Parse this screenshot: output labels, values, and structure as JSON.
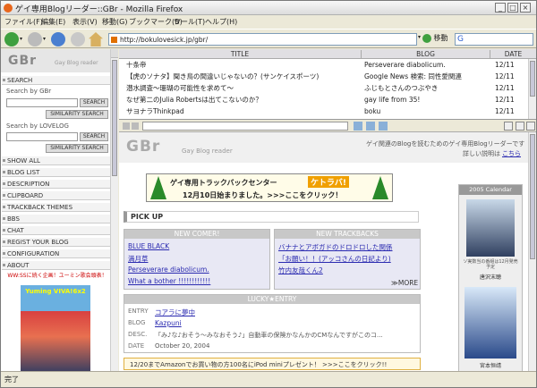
{
  "window": {
    "title": "ゲイ専用Blogリーダー::GBr - Mozilla Firefox"
  },
  "menu": [
    "ファイル(F)",
    "編集(E)",
    "表示(V)",
    "移動(G)",
    "ブックマーク(B)",
    "ツール(T)",
    "ヘルプ(H)"
  ],
  "toolbar": {
    "url": "http://bokulovesick.jp/gbr/",
    "go": "移動"
  },
  "sidebar": {
    "logo": "GBr",
    "logo_sub": "Gay Blog reader",
    "search_head": "SEARCH",
    "search_gbr_label": "Search by GBr",
    "search_btn": "SEARCH",
    "similarity_btn": "SIMILARITY SEARCH",
    "search_love_label": "Search by LOVELOG",
    "search_btn2": "SEARCH",
    "similarity_btn2": "SIMILARITY SEARCH",
    "items": [
      "SHOW ALL",
      "BLOG LIST",
      "DESCRIPTION",
      "CLIPBOARD",
      "TRACKBACK THEMES",
      "BBS",
      "CHAT",
      "REGIST YOUR BLOG",
      "CONFIGURATION",
      "ABOUT"
    ],
    "ad_text": "WW:SSに続く企画！ユーミン歌会頭表！",
    "ad_title": "Yuming VIVA!6x2"
  },
  "list": {
    "headers": [
      "TITLE",
      "BLOG",
      "DATE"
    ],
    "rows": [
      [
        "十条帝",
        "Perseverare diabolicum.",
        "12/11"
      ],
      [
        "【虎のソナタ】聞き鳥の間違いじゃないの？(サンケイスポーツ)",
        "Google News 検索: 同性愛関連",
        "12/11"
      ],
      [
        "潜水調査〜珊瑚の可能性を求めて〜",
        "ふじもとさんのつぶやき",
        "12/11"
      ],
      [
        "なぜ第二のJulia Robertsは出てこないのか？",
        "gay life from 35!",
        "12/11"
      ],
      [
        "サヨナラThinkpad",
        "boku",
        "12/11"
      ]
    ]
  },
  "content": {
    "logo": "GBr",
    "logo_sub": "Gay Blog reader",
    "desc": "ゲイ関連のBlogを読むためのゲイ専用Blogリーダーです",
    "desc_link_pre": "詳しい説明は",
    "desc_link": "こちら",
    "banner_line1": "ゲイ専用トラックバックセンター",
    "banner_brand": "ケトラバ!",
    "banner_line2": "12月10日始まりました。>>>ここをクリック！",
    "calendar_head": "2005 Calendar",
    "calendar_caption": "ソ実数当の番組は12月発売予定",
    "calendar_name": "唐沢末聴",
    "calendar_name2": "宮本恒靖",
    "pickup": "PICK UP",
    "newcomer_head": "NEW COMER!",
    "newcomers": [
      "BLUE BLACK",
      "満月草",
      "Perseverare diabolicum.",
      "What a bother !!!!!!!!!!!!"
    ],
    "trackback_head": "NEW TRACKBACKS",
    "trackbacks": [
      "バナナとアボガドのドロドロした関係",
      "「お願い！！(アッコさんの日記より)",
      "竹内友哉くん2"
    ],
    "more": "≫MORE",
    "lucky_head": "LUCKY★ENTRY",
    "lucky": {
      "entry_label": "ENTRY",
      "entry": "コアラに夢中",
      "blog_label": "BLOG",
      "blog": "Kazpuni",
      "desc_label": "DESC.",
      "desc": "「み♪な♪おそう〜みなおそう♪」自動車の保険かなんかのCMなんですがこのコ...",
      "date_label": "DATE",
      "date": "October 20, 2004"
    },
    "promo": "12/20までAmazonでお買い物の方100名にiPod miniプレゼント！ >>>ここをクリック!!"
  },
  "status": "完了",
  "colors": {
    "link": "#2a2ab0",
    "accent": "#e07000"
  }
}
